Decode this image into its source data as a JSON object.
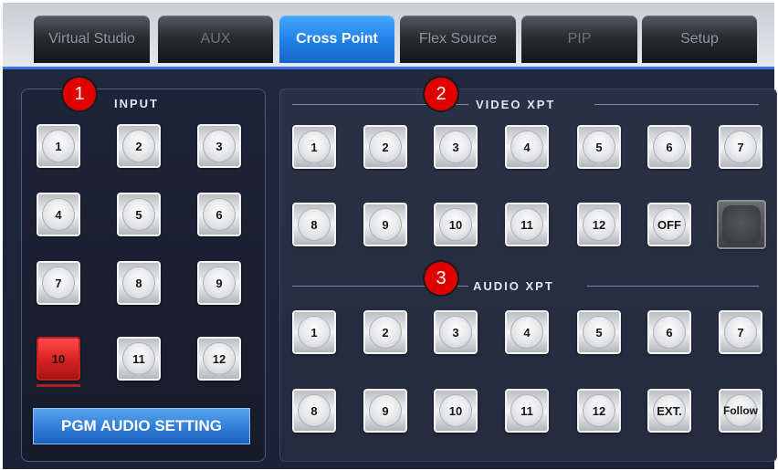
{
  "tabs": [
    "Virtual Studio",
    "AUX",
    "Cross Point",
    "Flex Source",
    "PIP",
    "Setup"
  ],
  "input_panel": {
    "title": "INPUT",
    "buttons": [
      "1",
      "2",
      "3",
      "4",
      "5",
      "6",
      "7",
      "8",
      "9",
      "10",
      "11",
      "12"
    ],
    "selected": "10",
    "pgm_audio_label": "PGM AUDIO SETTING"
  },
  "video_xpt": {
    "title": "VIDEO XPT",
    "buttons": [
      "1",
      "2",
      "3",
      "4",
      "5",
      "6",
      "7",
      "8",
      "9",
      "10",
      "11",
      "12",
      "OFF"
    ]
  },
  "audio_xpt": {
    "title": "AUDIO XPT",
    "buttons": [
      "1",
      "2",
      "3",
      "4",
      "5",
      "6",
      "7",
      "8",
      "9",
      "10",
      "11",
      "12",
      "EXT.",
      "Follow"
    ]
  },
  "markers": [
    "1",
    "2",
    "3"
  ],
  "colors": {
    "active_tab": "#1f7fe8",
    "selected_input": "#d62121",
    "pgm_button": "#2d79d6",
    "marker": "#e00000",
    "panel_bg": "#20283d"
  }
}
